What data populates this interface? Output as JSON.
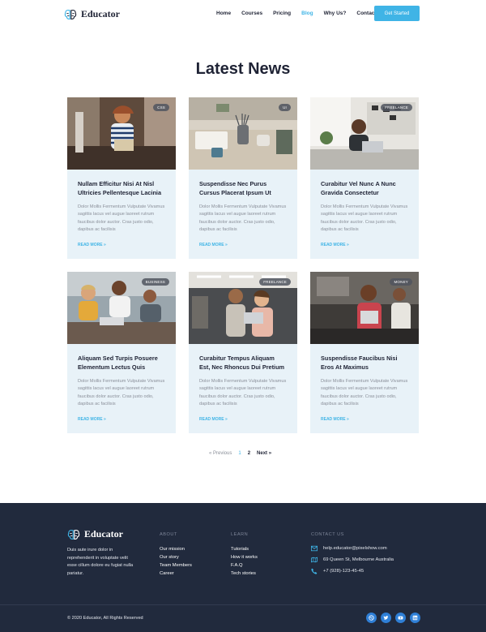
{
  "brand": "Educator",
  "nav": {
    "items": [
      {
        "label": "Home",
        "active": false
      },
      {
        "label": "Courses",
        "active": false
      },
      {
        "label": "Pricing",
        "active": false
      },
      {
        "label": "Blog",
        "active": true
      },
      {
        "label": "Why Us?",
        "active": false
      },
      {
        "label": "Contacts",
        "active": false
      }
    ],
    "cta": "Get Started"
  },
  "section_title": "Latest News",
  "posts": [
    {
      "tag": "CSS",
      "title": "Nullam Efficitur Nisi At Nisl Ultricies Pellentesque Lacinia",
      "excerpt": "Dolor Mollis Fermentum Vulputate Vivamus sagittis lacus vel augue laoreet rutrum faucibus dolor auctor. Cras justo odio, dapibus ac facilisis",
      "more": "READ MORE »"
    },
    {
      "tag": "UI",
      "title": "Suspendisse Nec Purus Cursus Placerat Ipsum Ut",
      "excerpt": "Dolor Mollis Fermentum Vulputate Vivamus sagittis lacus vel augue laoreet rutrum faucibus dolor auctor. Cras justo odio, dapibus ac facilisis",
      "more": "READ MORE »"
    },
    {
      "tag": "FREELANCE",
      "title": "Curabitur Vel Nunc A Nunc Gravida Consectetur",
      "excerpt": "Dolor Mollis Fermentum Vulputate Vivamus sagittis lacus vel augue laoreet rutrum faucibus dolor auctor. Cras justo odio, dapibus ac facilisis",
      "more": "READ MORE »"
    },
    {
      "tag": "BUSINESS",
      "title": "Aliquam Sed Turpis Posuere Elementum Lectus Quis",
      "excerpt": "Dolor Mollis Fermentum Vulputate Vivamus sagittis lacus vel augue laoreet rutrum faucibus dolor auctor. Cras justo odio, dapibus ac facilisis",
      "more": "READ MORE »"
    },
    {
      "tag": "FREELANCE",
      "title": "Curabitur Tempus Aliquam Est, Nec Rhoncus Dui Pretium",
      "excerpt": "Dolor Mollis Fermentum Vulputate Vivamus sagittis lacus vel augue laoreet rutrum faucibus dolor auctor. Cras justo odio, dapibus ac facilisis",
      "more": "READ MORE »"
    },
    {
      "tag": "MONEY",
      "title": "Suspendisse Faucibus Nisi Eros At Maximus",
      "excerpt": "Dolor Mollis Fermentum Vulputate Vivamus sagittis lacus vel augue laoreet rutrum faucibus dolor auctor. Cras justo odio, dapibus ac facilisis",
      "more": "READ MORE »"
    }
  ],
  "pagination": {
    "prev": "« Previous",
    "pages": [
      "1",
      "2"
    ],
    "current": "1",
    "next": "Next »"
  },
  "footer": {
    "brand": "Educator",
    "about_text": "Duis aute irure dolor in reprehenderit in voluptate velit esse cillum dolore eu fugiat nulla pariatur.",
    "about": {
      "heading": "ABOUT",
      "links": [
        "Our mission",
        "Our story",
        "Team Members",
        "Career"
      ]
    },
    "learn": {
      "heading": "LEARN",
      "links": [
        "Tutorials",
        "How it works",
        "F.A.Q",
        "Tech stories"
      ]
    },
    "contact": {
      "heading": "CONTACT US",
      "email": "help.educator@pixelshow.com",
      "address": "69 Queen St, Melbourne Australia",
      "phone": "+7 (928)-123-45-45"
    },
    "copyright": "© 2020 Educator, All Rights Reserved",
    "socials": [
      "dribbble-icon",
      "twitter-icon",
      "youtube-icon",
      "linkedin-icon"
    ]
  },
  "colors": {
    "accent": "#3fb4e6",
    "dark": "#212a3d",
    "card": "#e8f2f8"
  }
}
